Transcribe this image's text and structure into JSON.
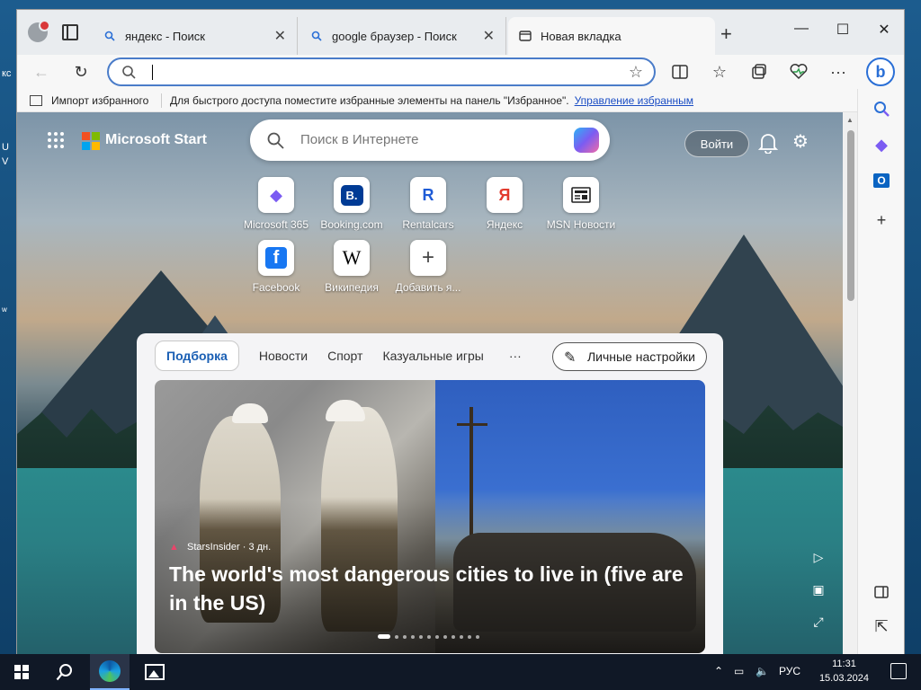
{
  "desktop": {
    "edge_labels": [
      "кс",
      "U",
      "V",
      "w"
    ]
  },
  "browser": {
    "tabs": [
      {
        "title": "яндекс - Поиск",
        "active": false
      },
      {
        "title": "google браузер - Поиск",
        "active": false
      },
      {
        "title": "Новая вкладка",
        "active": true
      }
    ],
    "address": {
      "value": "",
      "placeholder": ""
    },
    "favorites_bar": {
      "import_label": "Импорт избранного",
      "message": "Для быстрого доступа поместите избранные элементы на панель \"Избранное\".",
      "manage_link": "Управление избранным"
    }
  },
  "ms_start": {
    "brand": "Microsoft Start",
    "search_placeholder": "Поиск в Интернете",
    "login_label": "Войти",
    "logo_colors": [
      "#f25022",
      "#7fba00",
      "#00a4ef",
      "#ffb900"
    ]
  },
  "tiles": [
    {
      "label": "Microsoft 365",
      "icon": "microsoft-365-icon",
      "glyph": "◆",
      "color": "#7b5cf2"
    },
    {
      "label": "Booking.com",
      "icon": "booking-icon",
      "glyph": "B.",
      "color": "#003b95"
    },
    {
      "label": "Rentalcars",
      "icon": "rentalcars-icon",
      "glyph": "R",
      "color": "#1e5bd6"
    },
    {
      "label": "Яндекс",
      "icon": "yandex-icon",
      "glyph": "Я",
      "color": "#e23b2e"
    },
    {
      "label": "MSN Новости",
      "icon": "msn-news-icon",
      "glyph": "▤",
      "color": "#222"
    },
    {
      "label": "Facebook",
      "icon": "facebook-icon",
      "glyph": "f",
      "color": "#1877f2"
    },
    {
      "label": "Википедия",
      "icon": "wikipedia-icon",
      "glyph": "W",
      "color": "#222"
    },
    {
      "label": "Добавить я...",
      "icon": "add-icon",
      "glyph": "+",
      "color": "#444"
    }
  ],
  "feed": {
    "tabs": [
      "Подборка",
      "Новости",
      "Спорт",
      "Казуальные игры"
    ],
    "more": "···",
    "personal_label": "Личные настройки",
    "hero": {
      "source": "StarsInsider · 3 дн.",
      "headline": "The world's most dangerous cities to live in (five are in the US)",
      "slides_total": 12,
      "slide_current": 1
    }
  },
  "taskbar": {
    "language": "РУС",
    "time": "11:31",
    "date": "15.03.2024"
  }
}
